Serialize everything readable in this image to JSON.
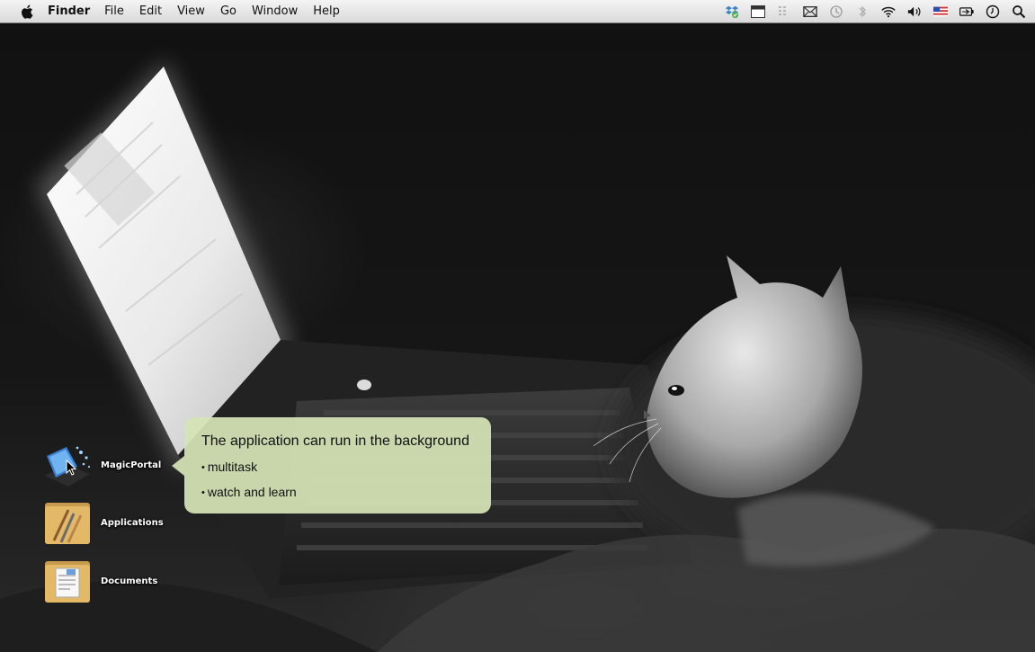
{
  "menubar": {
    "app_name": "Finder",
    "items": [
      "File",
      "Edit",
      "View",
      "Go",
      "Window",
      "Help"
    ],
    "status_icons": [
      "dropbox-icon",
      "calendar-icon",
      "columns-icon",
      "mail-icon",
      "time-machine-icon",
      "bluetooth-icon",
      "wifi-icon",
      "volume-icon",
      "flag-us-icon",
      "battery-icon",
      "clock-icon",
      "spotlight-icon"
    ]
  },
  "desktop": {
    "icons": [
      {
        "label": "MagicPortal",
        "icon": "magicportal-icon"
      },
      {
        "label": "Applications",
        "icon": "applications-folder-icon"
      },
      {
        "label": "Documents",
        "icon": "documents-folder-icon"
      }
    ]
  },
  "callout": {
    "title": "The application can run in the background",
    "items": [
      "multitask",
      "watch and learn"
    ],
    "bullet": "•",
    "background_color": "#d6e4b7"
  },
  "wallpaper": {
    "subject": "kitten-laptop-wallpaper",
    "style": "black-and-white"
  }
}
